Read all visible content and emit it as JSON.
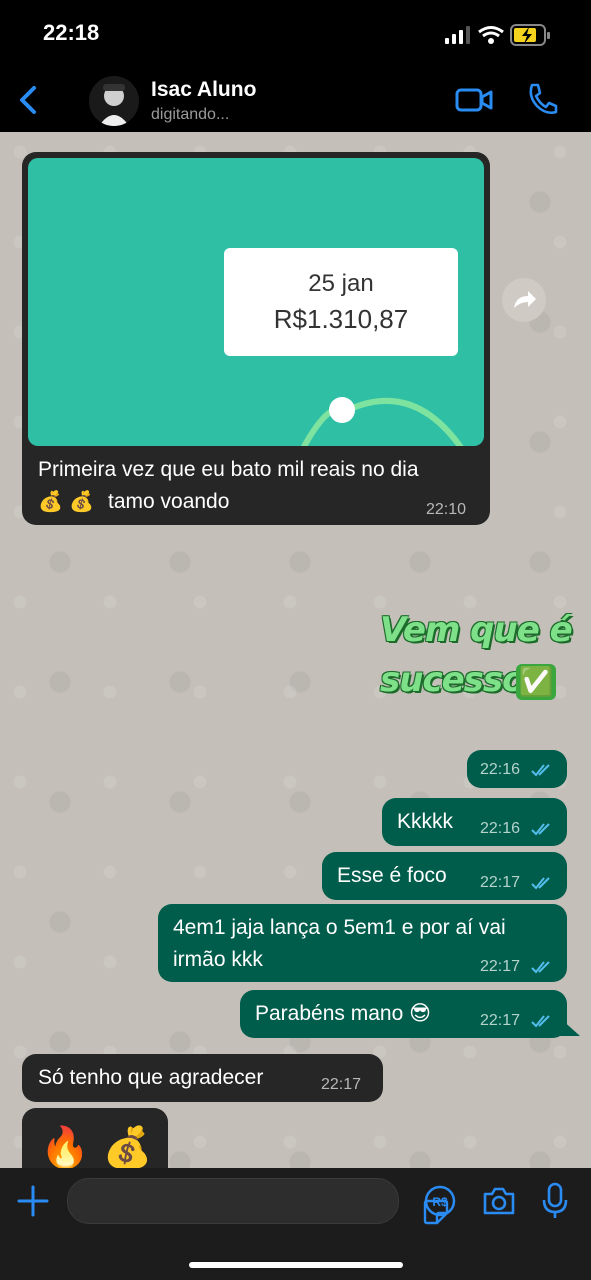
{
  "status_bar": {
    "time": "22:18"
  },
  "header": {
    "name": "Isac Aluno",
    "status": "digitando..."
  },
  "image_message": {
    "card_date": "25 jan",
    "card_amount": "R$1.310,87",
    "caption_line1": "Primeira vez que eu bato mil reais no dia",
    "caption_line2_emojis": "💰 💰",
    "caption_line2_text": "tamo voando",
    "time": "22:10"
  },
  "sticker": {
    "line1": "Vem que é",
    "line2": "sucesso",
    "emoji": "✅"
  },
  "messages": [
    {
      "direction": "out",
      "text": "",
      "time": "22:16"
    },
    {
      "direction": "out",
      "text": "Kkkkk",
      "time": "22:16"
    },
    {
      "direction": "out",
      "text": "Esse é foco",
      "time": "22:17"
    },
    {
      "direction": "out",
      "text_line1": "4em1 jaja lança o 5em1 e por aí vai",
      "text_line2": "irmão kkk",
      "time": "22:17"
    },
    {
      "direction": "out",
      "text": "Parabéns mano 😎",
      "time": "22:17"
    },
    {
      "direction": "in",
      "text": "Só tenho que agradecer",
      "time": "22:17"
    },
    {
      "direction": "in",
      "text": "🔥 💰",
      "time": ""
    }
  ],
  "colors": {
    "accent": "#2a8bf2",
    "outgoing_bubble": "#005c4b",
    "incoming_bubble": "#262626",
    "read_ticks": "#53bdeb"
  },
  "icons": [
    "back-icon",
    "video-call-icon",
    "phone-icon",
    "forward-icon",
    "plus-icon",
    "sticker-icon",
    "payment-icon",
    "camera-icon",
    "mic-icon"
  ]
}
